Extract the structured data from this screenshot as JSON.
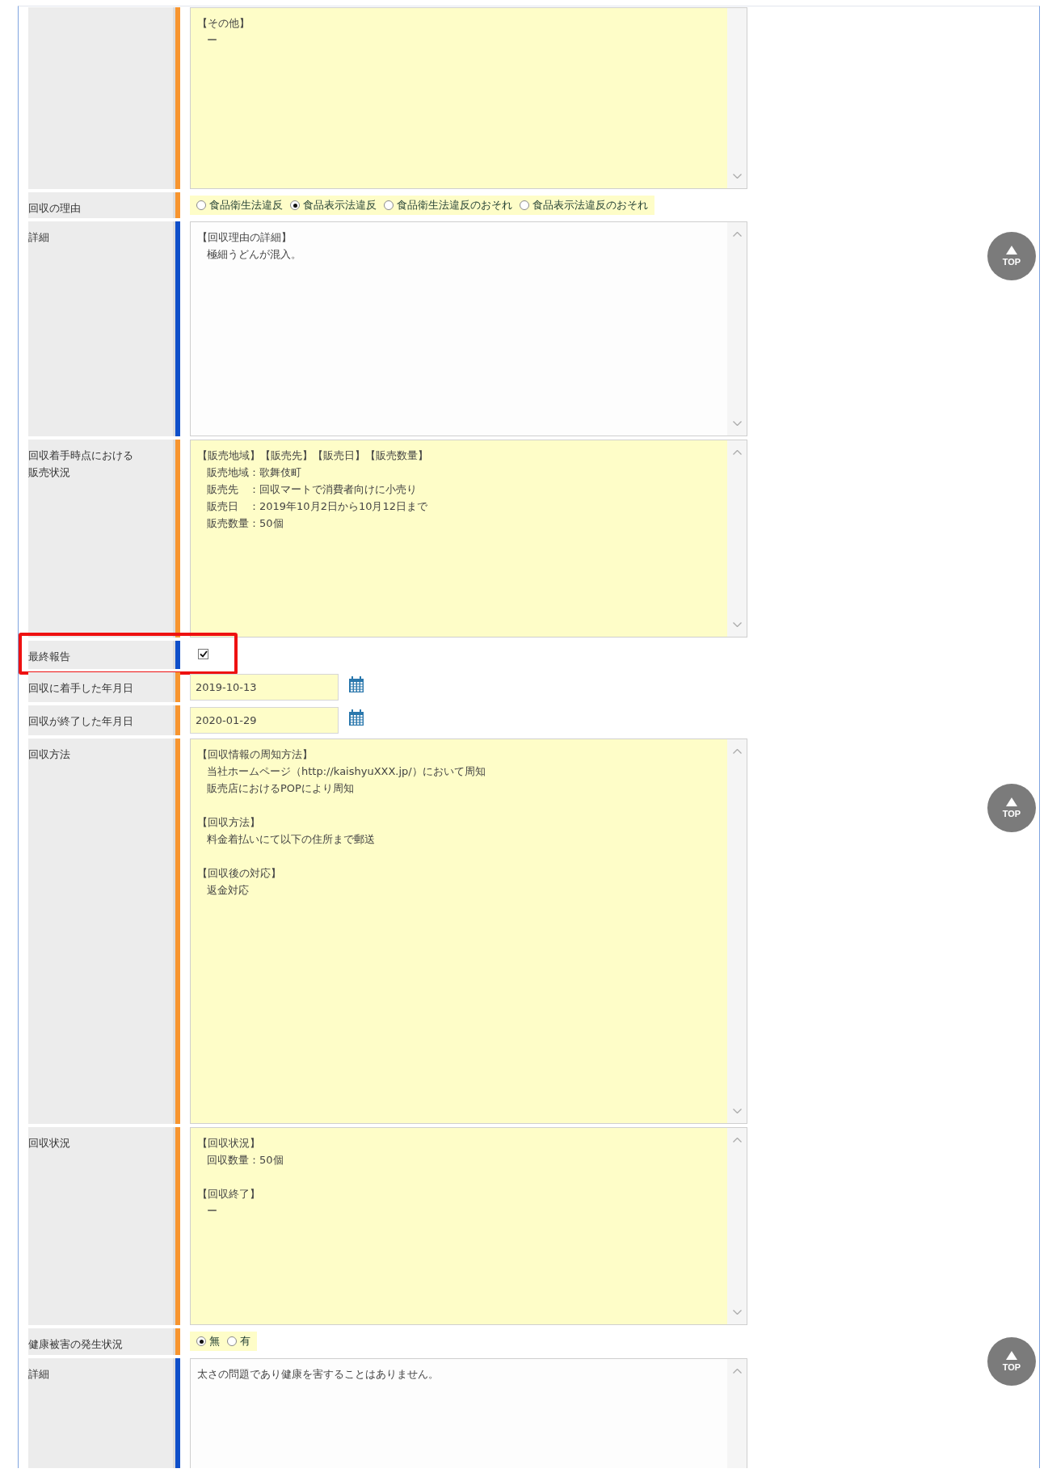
{
  "rows": [
    {
      "label": [],
      "color": "#f7952f",
      "field": {
        "kind": "textarea",
        "highlighted": true,
        "blocks": [
          [
            "【その他】",
            "ー"
          ]
        ]
      }
    },
    {
      "label": [
        "回収の理由"
      ],
      "color": "#f7952f",
      "field": {
        "kind": "radio",
        "highlighted": true,
        "options": [
          {
            "label": "食品衛生法違反",
            "selected": false
          },
          {
            "label": "食品表示法違反",
            "selected": true
          },
          {
            "label": "食品衛生法違反のおそれ",
            "selected": false
          },
          {
            "label": "食品表示法違反のおそれ",
            "selected": false
          }
        ]
      }
    },
    {
      "label": [
        "詳細"
      ],
      "color": "#0f4fc9",
      "field": {
        "kind": "textarea",
        "highlighted": false,
        "blocks": [
          [
            "【回収理由の詳細】",
            "極細うどんが混入。"
          ]
        ]
      }
    },
    {
      "label": [
        "回収着手時点における",
        "販売状況"
      ],
      "color": "#f7952f",
      "field": {
        "kind": "textarea",
        "highlighted": true,
        "blocks": [
          [
            "【販売地域】【販売先】【販売日】【販売数量】",
            "販売地域：歌舞伎町",
            "販売先　：回収マートで消費者向けに小売り",
            "販売日　：2019年10月2日から10月12日まで",
            "販売数量：50個"
          ]
        ]
      }
    },
    {
      "label": [
        "最終報告"
      ],
      "color": "#0f4fc9",
      "framed": true,
      "field": {
        "kind": "checkbox",
        "checked": true
      }
    },
    {
      "label": [
        "回収に着手した年月日"
      ],
      "color": "#f7952f",
      "field": {
        "kind": "date",
        "highlighted": true,
        "value": "2019-10-13"
      }
    },
    {
      "label": [
        "回収が終了した年月日"
      ],
      "color": "#f7952f",
      "field": {
        "kind": "date",
        "highlighted": true,
        "value": "2020-01-29"
      }
    },
    {
      "label": [
        "回収方法"
      ],
      "color": "#f7952f",
      "field": {
        "kind": "textarea",
        "highlighted": true,
        "blocks": [
          [
            "【回収情報の周知方法】",
            "当社ホームページ（http://kaishyuXXX.jp/）において周知",
            "販売店におけるPOPにより周知"
          ],
          [
            "【回収方法】",
            "料金着払いにて以下の住所まで郵送"
          ],
          [
            "【回収後の対応】",
            "返金対応"
          ]
        ]
      }
    },
    {
      "label": [
        "回収状況"
      ],
      "color": "#f7952f",
      "field": {
        "kind": "textarea",
        "highlighted": true,
        "blocks": [
          [
            "【回収状況】",
            "回収数量：50個"
          ],
          [
            "【回収終了】",
            "ー"
          ]
        ]
      }
    },
    {
      "label": [
        "健康被害の発生状況"
      ],
      "color": "#f7952f",
      "field": {
        "kind": "radio",
        "highlighted": true,
        "options": [
          {
            "label": "無",
            "selected": true
          },
          {
            "label": "有",
            "selected": false
          }
        ]
      }
    },
    {
      "label": [
        "詳細"
      ],
      "color": "#0f4fc9",
      "field": {
        "kind": "textarea",
        "highlighted": false,
        "blocks": [
          [
            "太さの問題であり健康を害することはありません。"
          ]
        ]
      }
    }
  ],
  "top_buttons": [
    {
      "label": "TOP"
    },
    {
      "label": "TOP"
    },
    {
      "label": "TOP"
    }
  ]
}
